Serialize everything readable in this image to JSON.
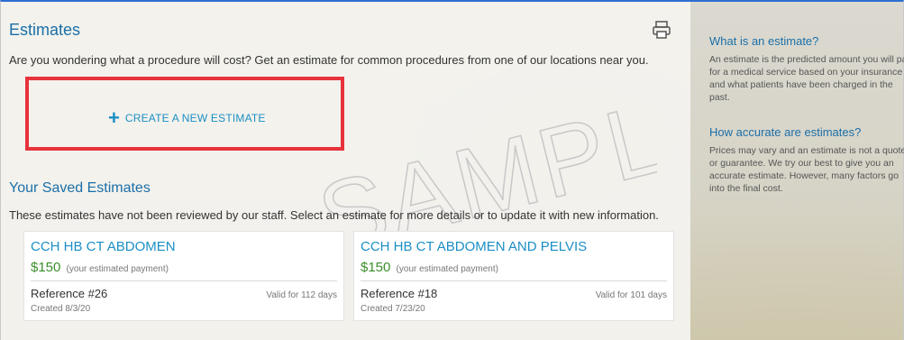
{
  "estimates": {
    "title": "Estimates",
    "intro": "Are you wondering what a procedure will cost? Get an estimate for common procedures from one of our locations near you.",
    "create_label": "CREATE A NEW ESTIMATE",
    "watermark": "SAMPLE"
  },
  "saved": {
    "title": "Your Saved Estimates",
    "description": "These estimates have not been reviewed by our staff. Select an estimate for more details or to update it with new information.",
    "cards": [
      {
        "title": "CCH HB CT ABDOMEN",
        "price": "$150",
        "price_note": "(your estimated payment)",
        "reference": "Reference #26",
        "valid": "Valid for 112 days",
        "created": "Created 8/3/20"
      },
      {
        "title": "CCH HB CT ABDOMEN AND PELVIS",
        "price": "$150",
        "price_note": "(your estimated payment)",
        "reference": "Reference #18",
        "valid": "Valid for 101 days",
        "created": "Created 7/23/20"
      }
    ]
  },
  "sidebar": {
    "q1_title": "What is an estimate?",
    "q1_body": "An estimate is the predicted amount you will pay for a medical service based on your insurance and what patients have been charged in the past.",
    "q2_title": "How accurate are estimates?",
    "q2_body": "Prices may vary and an estimate is not a quote or guarantee. We try our best to give you an accurate estimate. However, many factors go into the final cost."
  },
  "icons": {
    "print": "print-icon",
    "plus": "plus-icon"
  },
  "colors": {
    "link": "#1b8fc4",
    "title": "#1b6fa8",
    "price": "#3a8f2a",
    "highlight": "#e8323c",
    "frame": "#2e6fd1"
  }
}
